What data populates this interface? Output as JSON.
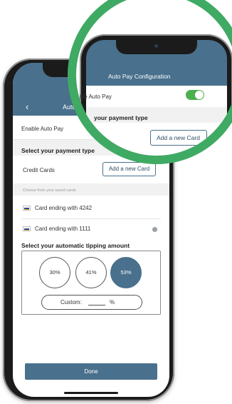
{
  "app": {
    "header_title": "Auto Pay",
    "back_glyph": "‹"
  },
  "autopay": {
    "label": "Enable Auto Pay"
  },
  "payment": {
    "section_title": "Select your payment type",
    "method_label": "Credit Cards",
    "add_card_label": "Add a new Card",
    "hint": "Choose from your saved cards",
    "cards": [
      {
        "label": "Card ending with 4242",
        "selected": false
      },
      {
        "label": "Card ending with 1111",
        "selected": true
      }
    ]
  },
  "tipping": {
    "section_title": "Select your automatic tipping amount",
    "options": [
      {
        "label": "30%",
        "selected": false
      },
      {
        "label": "41%",
        "selected": false
      },
      {
        "label": "53%",
        "selected": true
      }
    ],
    "custom_label": "Custom:",
    "custom_unit": "%"
  },
  "done_label": "Done",
  "zoom": {
    "title": "Auto Pay Configuration",
    "autopay_label": "ble Auto Pay",
    "toggle_on": true,
    "section_title": "your payment type",
    "add_card_label": "Add a new Card"
  },
  "colors": {
    "primary": "#49708c",
    "accent_ring": "#3faa63",
    "toggle_on": "#4caf50"
  },
  "icons": {
    "back": "chevron-left-icon",
    "card": "credit-card-icon",
    "check": "selected-check-icon"
  }
}
